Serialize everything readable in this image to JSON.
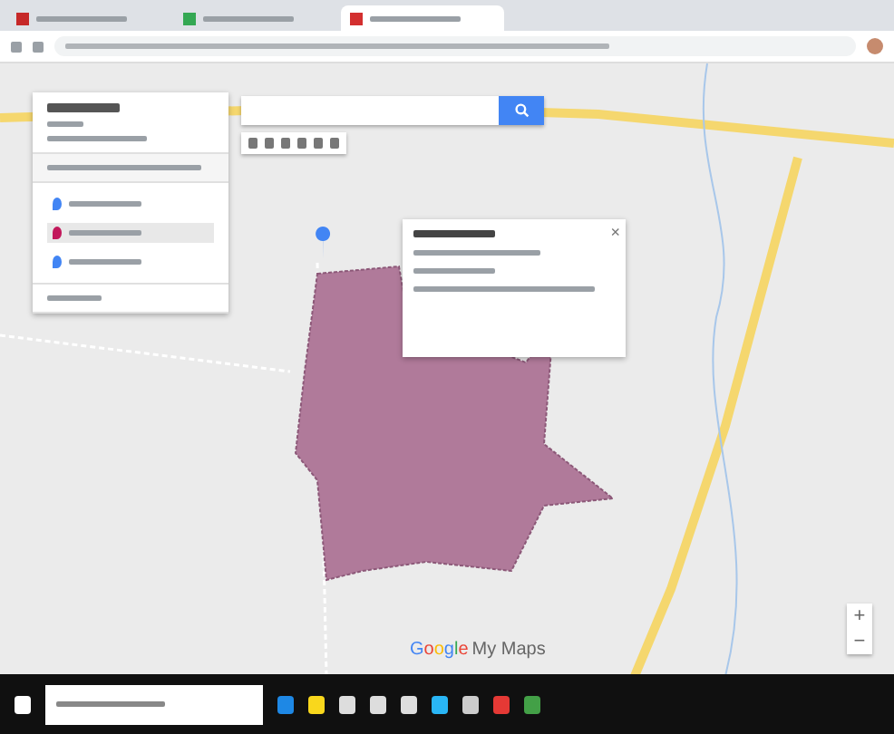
{
  "browser": {
    "tabs": [
      {
        "selected": false,
        "color": "#c62828"
      },
      {
        "selected": false,
        "color": "#34a853"
      },
      {
        "selected": true,
        "color": "#d32f2f"
      }
    ]
  },
  "side_panel": {
    "layer_items": [
      {
        "color": "#4285f4",
        "selected": false
      },
      {
        "color": "#c2185b",
        "selected": true
      },
      {
        "color": "#4285f4",
        "selected": false
      }
    ]
  },
  "popup": {
    "close": "×"
  },
  "map": {
    "logo": "Google",
    "logo_suffix": "My Maps",
    "zoom_controls": [
      "+",
      "−"
    ]
  }
}
